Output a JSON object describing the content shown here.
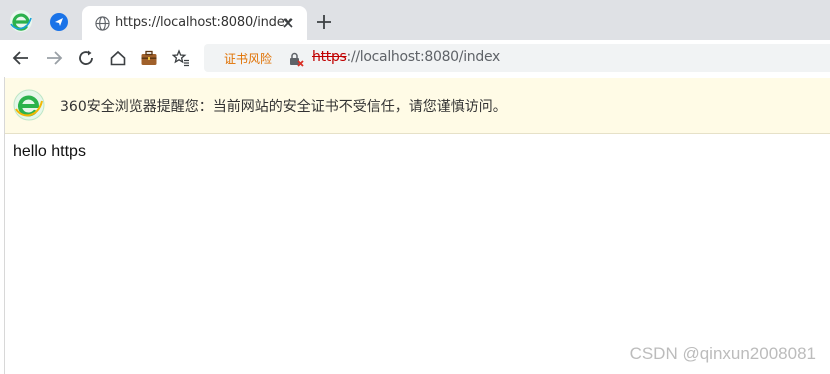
{
  "browser": {
    "tab": {
      "title": "https://localhost:8080/index"
    },
    "address_bar": {
      "risk_label": "证书风险",
      "url_protocol": "https",
      "url_rest": "://localhost:8080/index"
    }
  },
  "security_warning": {
    "message": "360安全浏览器提醒您：当前网站的安全证书不受信任，请您谨慎访问。"
  },
  "page": {
    "body_text": "hello https"
  },
  "watermark": "CSDN @qinxun2008081",
  "colors": {
    "tabbar_bg": "#dfe1e5",
    "warning_bg": "#fffbe6",
    "risk_text": "#e07000",
    "insecure_protocol": "#c00000",
    "brand_green": "#2bb24c",
    "pin_blue": "#1a73e8"
  }
}
